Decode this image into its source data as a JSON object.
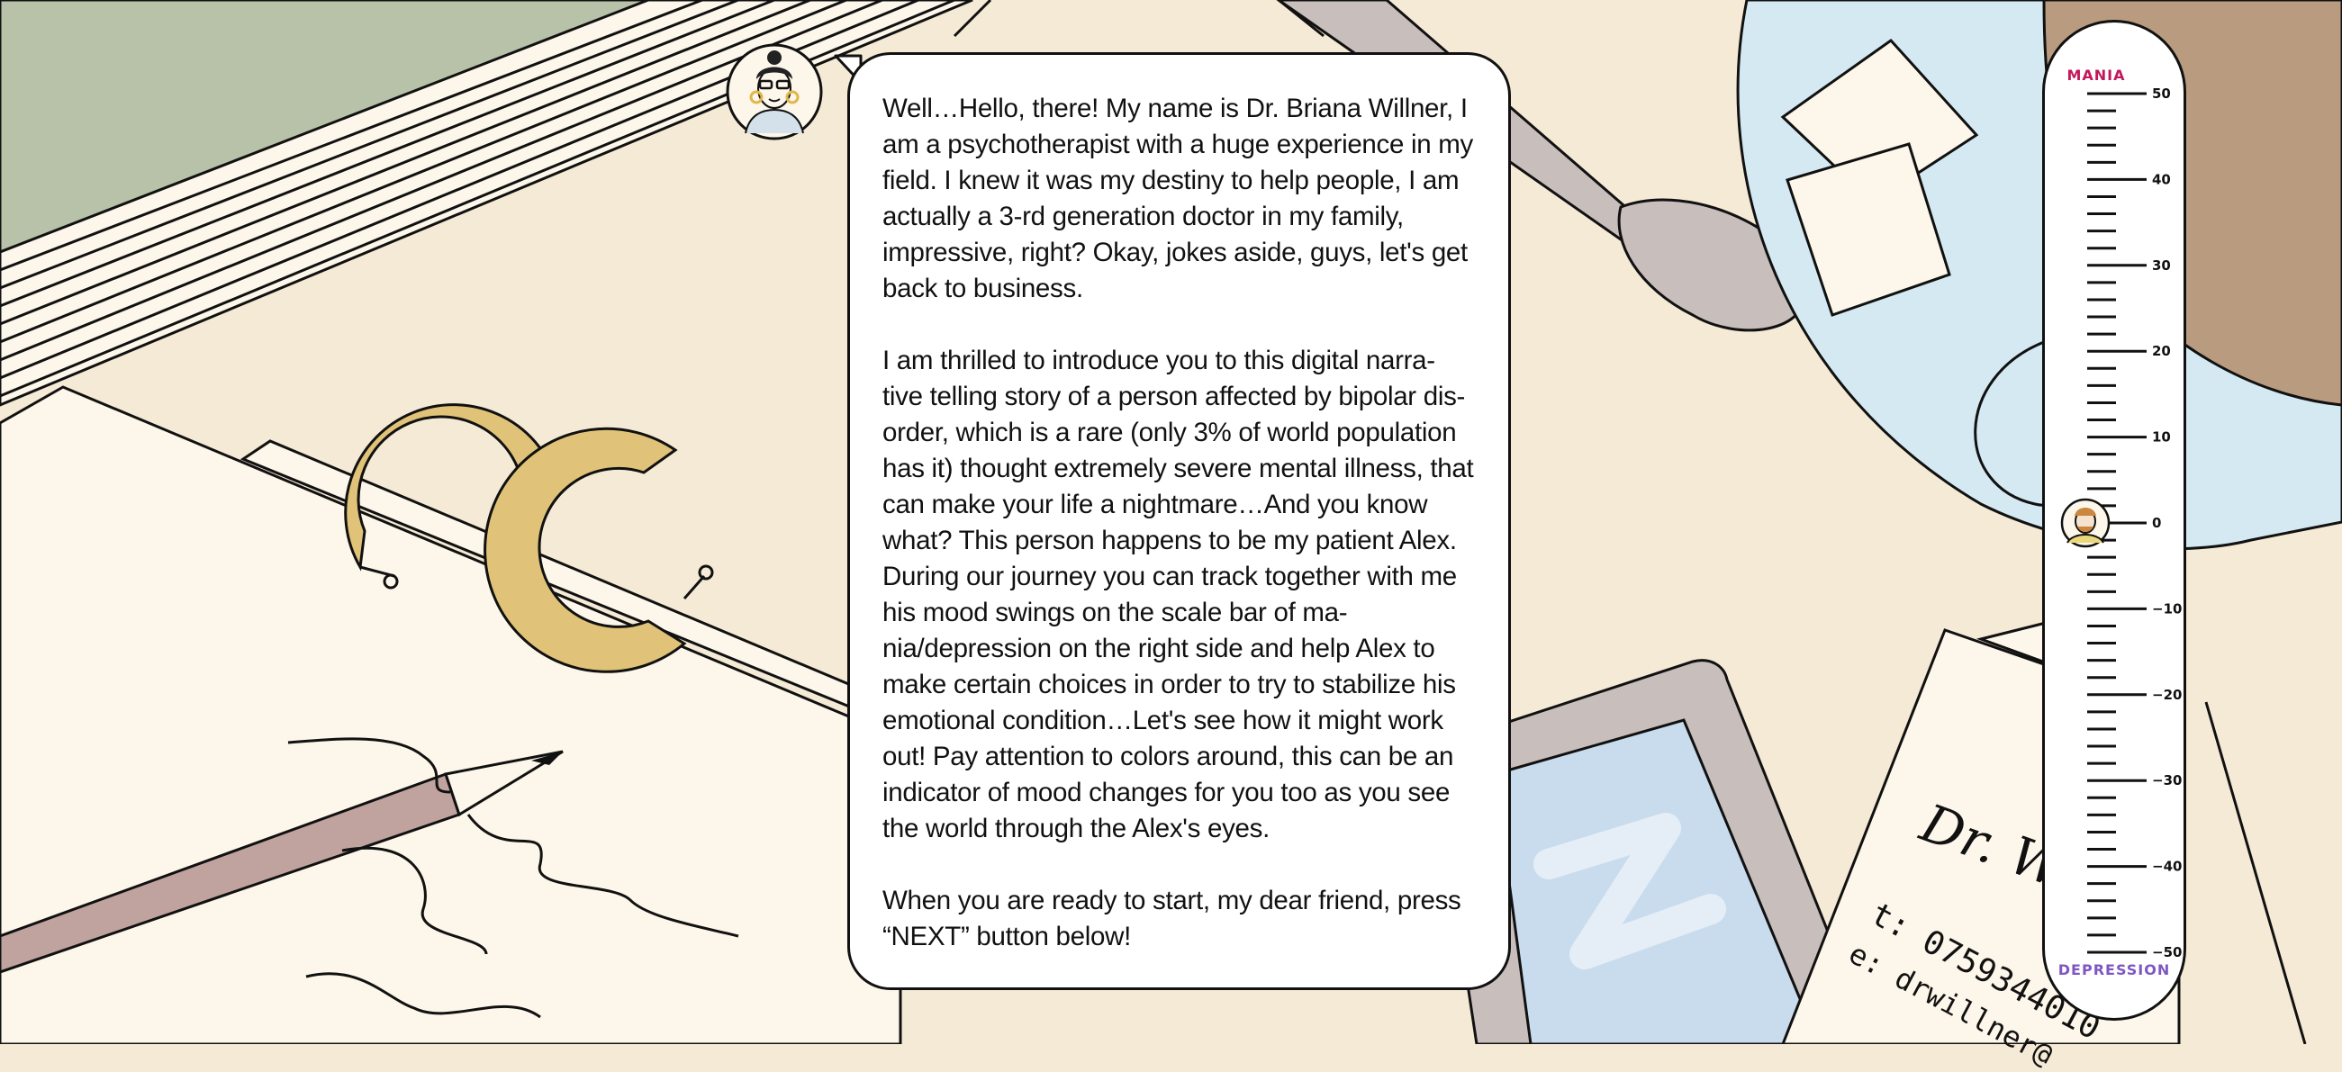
{
  "dialogue": {
    "paragraphs": [
      "Well…Hello, there! My name is Dr. Briana Willner, I am a psychotherapist with a huge experience in my field. I knew it was my destiny to help people, I am actually a 3-rd generation doctor in my family, impressive, right? Okay, jokes aside, guys, let's get back to business.",
      "I am thrilled to introduce you to this digital narra- tive telling story of a person affected by bipolar dis- order, which is a rare (only 3% of world population has it) thought extremely severe mental illness, that can make your life a nightmare…And you know what? This person happens to be my patient Alex. During our journey you can track together with me his mood swings on the scale bar of ma- nia/depression on the right side and help Alex to make certain choices in order to try to stabilize his emotional condition…Let's see how it might work out! Pay attention to colors around, this can be an indicator of mood changes for you too as you see the world through the Alex's eyes.",
      "When you are ready to start, my dear friend, press “NEXT” button below!"
    ]
  },
  "mood_scale": {
    "top_label": "MANIA",
    "bottom_label": "DEPRESSION",
    "ticks": [
      "50",
      "40",
      "30",
      "20",
      "10",
      "0",
      "−10",
      "−20",
      "−30",
      "−40",
      "−50"
    ],
    "current_value": 0,
    "colors": {
      "mania": "#c2185b",
      "depression": "#7e57c2"
    }
  },
  "business_card": {
    "name": "Dr. Wil",
    "phone": "t: 0759344010",
    "email": "e: drwillner@"
  },
  "icons": {
    "doctor": "doctor-avatar-icon",
    "patient": "patient-avatar-icon"
  }
}
